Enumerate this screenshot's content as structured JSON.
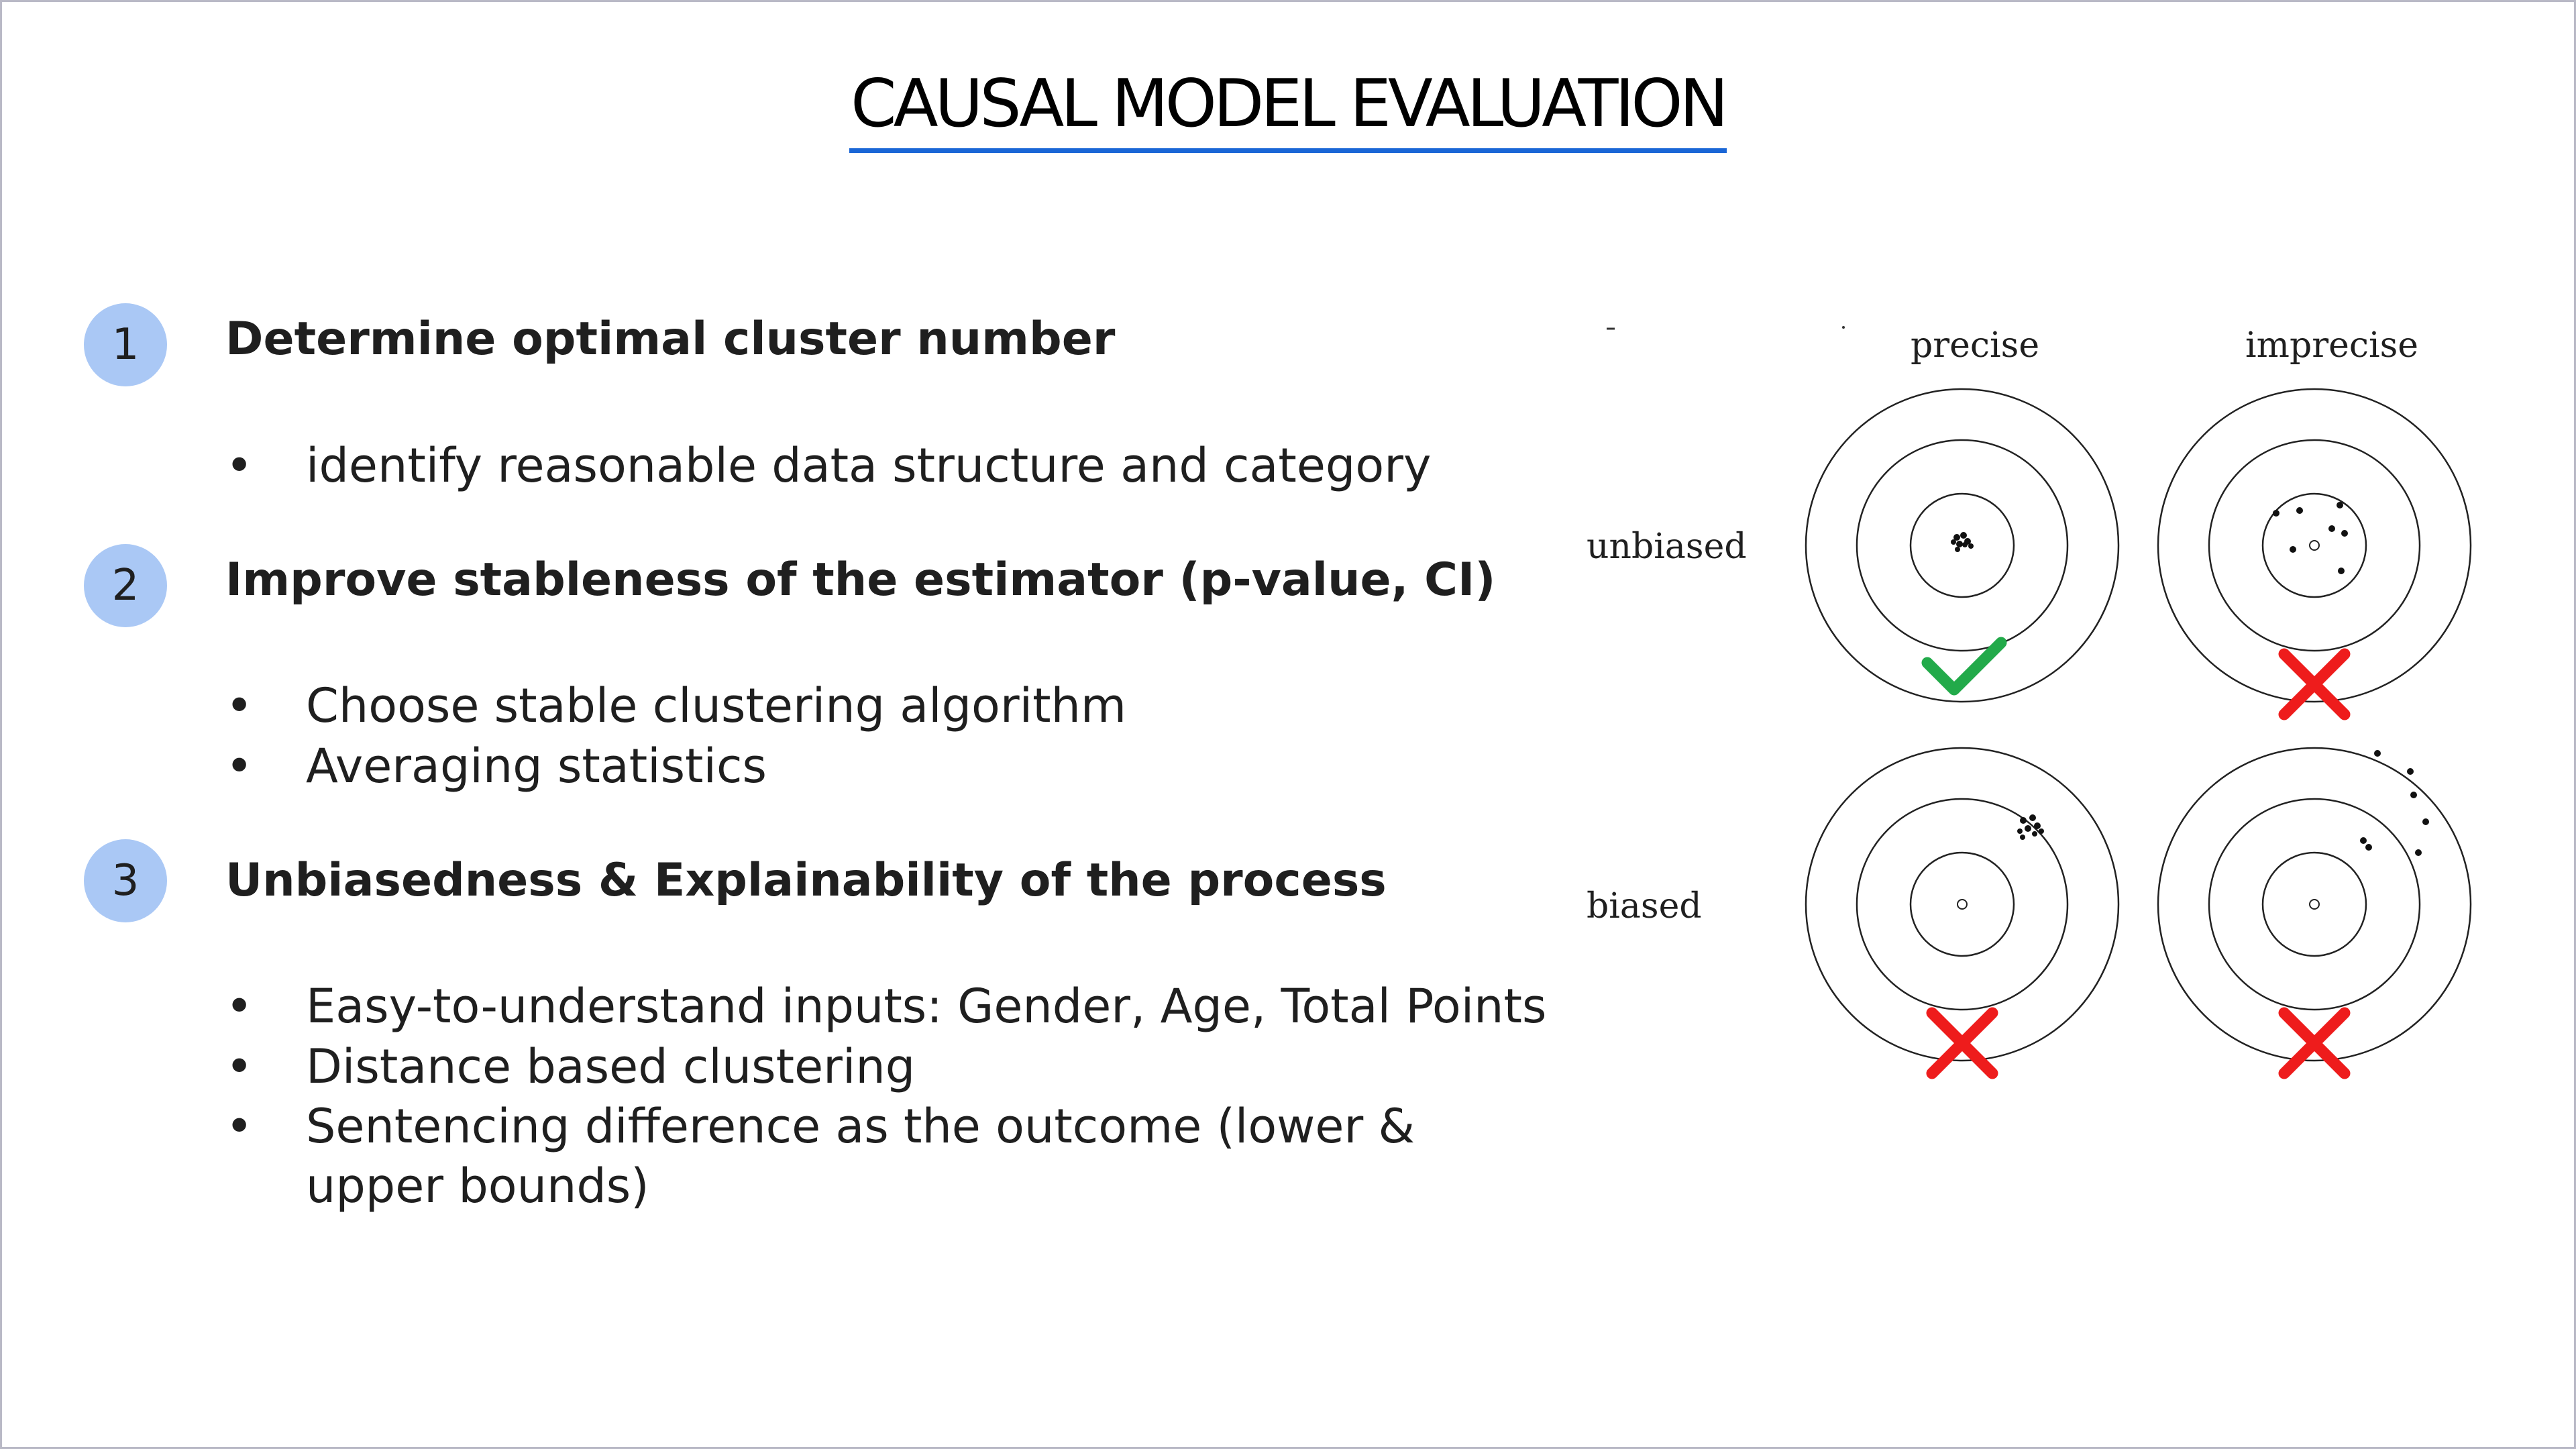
{
  "slide": {
    "title": "CAUSAL MODEL EVALUATION"
  },
  "sections": [
    {
      "number": "1",
      "heading": "Determine optimal cluster number",
      "bullets": [
        "identify reasonable data structure and category"
      ]
    },
    {
      "number": "2",
      "heading": "Improve stableness of the estimator (p-value, CI)",
      "bullets": [
        "Choose stable clustering algorithm",
        "Averaging statistics"
      ]
    },
    {
      "number": "3",
      "heading": "Unbiasedness & Explainability of the process",
      "bullets": [
        "Easy-to-understand inputs: Gender, Age, Total Points",
        "Distance based clustering",
        "Sentencing difference as the outcome (lower &",
        "upper bounds)"
      ]
    }
  ],
  "bullet_symbol": "•",
  "figure": {
    "col_labels": [
      "precise",
      "imprecise"
    ],
    "row_labels": [
      "unbiased",
      "biased"
    ],
    "marks": [
      "check",
      "cross",
      "cross",
      "cross"
    ],
    "colors": {
      "check": "#22aa4a",
      "cross": "#ee1c1c",
      "accent": "#1a66d6",
      "badge": "#aac8f5"
    }
  }
}
